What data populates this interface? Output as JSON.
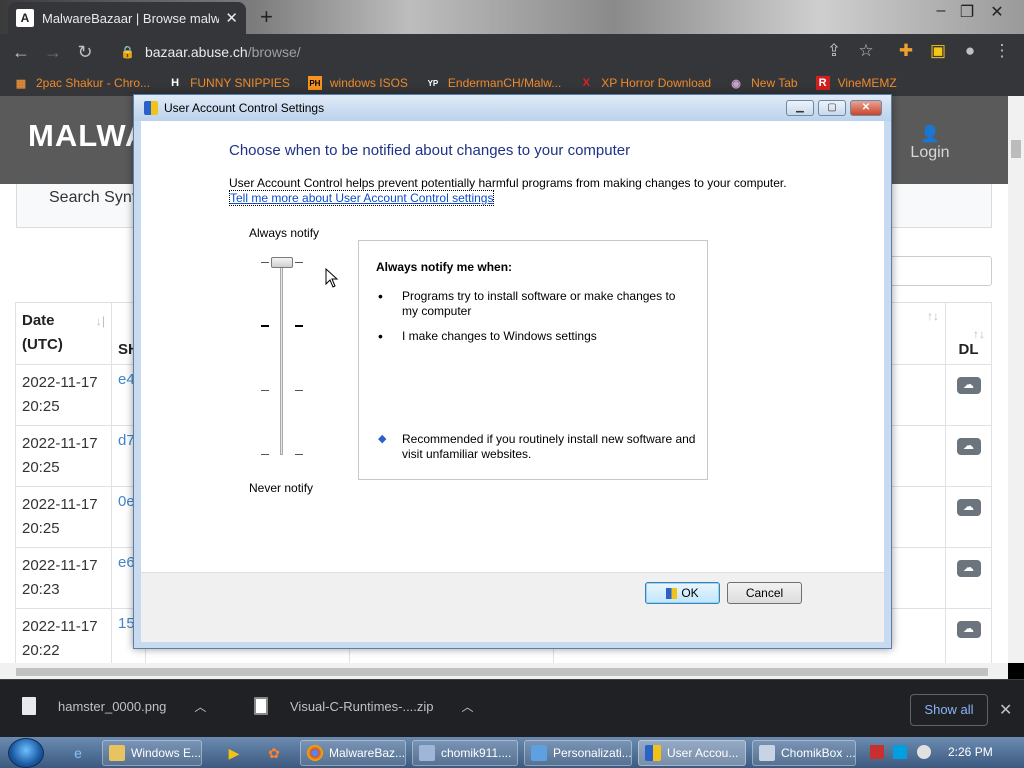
{
  "browser": {
    "tab_title": "MalwareBazaar | Browse malware",
    "tab_favicon": "A",
    "url_domain": "bazaar.abuse.ch",
    "url_path": "/browse/",
    "bookmarks": [
      {
        "label": "2pac Shakur - Chro...",
        "icon": "bookmark-icon"
      },
      {
        "label": "FUNNY SNIPPIES",
        "icon": "h-icon",
        "glyph": "H"
      },
      {
        "label": "windows ISOS",
        "icon": "ph-icon",
        "glyph": "PH"
      },
      {
        "label": "EndermanCH/Malw...",
        "icon": "yp-icon",
        "glyph": "YP"
      },
      {
        "label": "XP Horror Download",
        "icon": "x-icon",
        "glyph": "X"
      },
      {
        "label": "New Tab",
        "icon": "newtab-icon"
      },
      {
        "label": "VineMEMZ",
        "icon": "r-icon",
        "glyph": "R"
      }
    ]
  },
  "site": {
    "logo": "MALWA",
    "login": "Login",
    "search_label": "Search Synta",
    "table": {
      "headers": {
        "date": "Date (UTC)",
        "sha": "SH",
        "dl": "DL"
      },
      "rows": [
        {
          "date": "2022-11-17 20:25",
          "sha": "e4"
        },
        {
          "date": "2022-11-17 20:25",
          "sha": "d7"
        },
        {
          "date": "2022-11-17 20:25",
          "sha": "0e"
        },
        {
          "date": "2022-11-17 20:23",
          "sha": "e6"
        },
        {
          "date": "2022-11-17 20:22",
          "sha": "15"
        }
      ]
    }
  },
  "dialog": {
    "title": "User Account Control Settings",
    "heading": "Choose when to be notified about changes to your computer",
    "description": "User Account Control helps prevent potentially harmful programs from making changes to your computer.",
    "learn_more": "Tell me more about User Account Control settings",
    "slider_top_label": "Always notify",
    "slider_bottom_label": "Never notify",
    "slider_level": 4,
    "slider_levels": 4,
    "info_heading": "Always notify me when:",
    "bullets": [
      "Programs try to install software or make changes to my computer",
      "I make changes to Windows settings"
    ],
    "recommendation": "Recommended if you routinely install new software and visit unfamiliar websites.",
    "ok": "OK",
    "cancel": "Cancel"
  },
  "downloads": {
    "items": [
      "hamster_0000.png",
      "Visual-C-Runtimes-....zip"
    ],
    "show_all": "Show all"
  },
  "taskbar": {
    "tasks": [
      "Windows E...",
      "MalwareBaz...",
      "chomik911....",
      "Personalizati...",
      "User Accou...",
      "ChomikBox ..."
    ],
    "clock": "2:26 PM"
  },
  "colors": {
    "heading_blue": "#1e3287",
    "link_blue": "#0f4dcb",
    "chrome_dark": "#35363a",
    "site_header": "#5a5a5a"
  }
}
